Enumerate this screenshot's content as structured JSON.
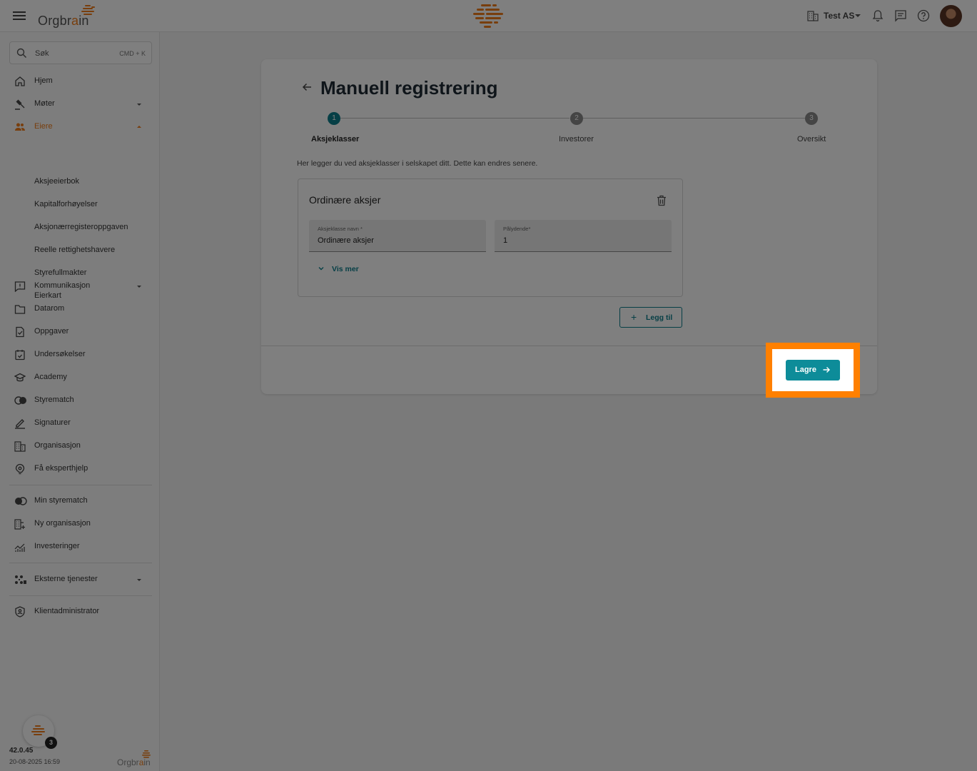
{
  "topbar": {
    "brand_prefix": "Orgbr",
    "brand_accent": "a",
    "brand_suffix": "in",
    "org_name": "Test AS"
  },
  "sidebar": {
    "search_label": "Søk",
    "search_shortcut": "CMD + K",
    "items": {
      "hjem": "Hjem",
      "moter": "Møter",
      "eiere": "Eiere",
      "kommunikasjon": "Kommunikasjon",
      "datarom": "Datarom",
      "oppgaver": "Oppgaver",
      "undersokelser": "Undersøkelser",
      "academy": "Academy",
      "styrematch": "Styrematch",
      "signaturer": "Signaturer",
      "organisasjon": "Organisasjon",
      "eksperthjelp": "Få eksperthjelp",
      "min_styrematch": "Min styrematch",
      "ny_organisasjon": "Ny organisasjon",
      "investeringer": "Investeringer",
      "eksterne_tjenester": "Eksterne tjenester",
      "klientadministrator": "Klientadministrator"
    },
    "eiere_sub": [
      "Aksjeeierbok",
      "Kapitalforhøyelser",
      "Aksjonærregisteroppgaven",
      "Reelle rettighetshavere",
      "Styrefullmakter",
      "Eierkart"
    ],
    "notification_count": "3",
    "version": "42.0.45",
    "build_date": "20-08-2025 16:59",
    "footer_brand_prefix": "Orgbr",
    "footer_brand_accent": "a",
    "footer_brand_suffix": "in"
  },
  "main": {
    "title": "Manuell registrering",
    "steps": [
      {
        "number": "1",
        "label": "Aksjeklasser",
        "active": true
      },
      {
        "number": "2",
        "label": "Investorer",
        "active": false
      },
      {
        "number": "3",
        "label": "Oversikt",
        "active": false
      }
    ],
    "intro": "Her legger du ved aksjeklasser i selskapet ditt. Dette kan endres senere.",
    "share_class": {
      "title": "Ordinære aksjer",
      "name_label": "Aksjeklasse navn *",
      "name_value": "Ordinære aksjer",
      "par_label": "Pålydende*",
      "par_value": "1",
      "show_more": "Vis mer"
    },
    "add_label": "Legg til",
    "save_label": "Lagre"
  },
  "colors": {
    "accent": "#0d7f8c",
    "brand_orange": "#f07d1a",
    "highlight": "#ff8000",
    "overlay": "rgba(0,0,0,0.5)"
  }
}
